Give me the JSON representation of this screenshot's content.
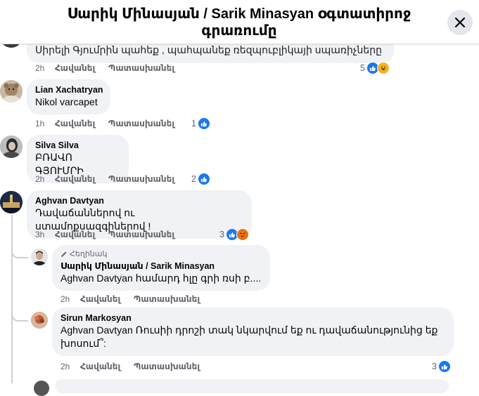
{
  "header": {
    "title": "Սարիկ Մինասյան / Sarik Minasyan օգտատիրոջ գրառումը",
    "close_label": "Close"
  },
  "comments": [
    {
      "id": "c0",
      "name": "",
      "text": "Սիրելի Գյումրին պահեք , պահպանեք ռեզպուբլիկայի սպառիչները",
      "time": "2h",
      "like": "Հավանել",
      "reply": "Պատասխանել",
      "react_count": "5",
      "reactions": [
        "like",
        "haha"
      ]
    },
    {
      "id": "c1",
      "name": "Lian Xachatryan",
      "text": "Nikol varcapet",
      "time": "1h",
      "like": "Հավանել",
      "reply": "Պատասխանել",
      "react_count": "1",
      "reactions": [
        "like"
      ]
    },
    {
      "id": "c2",
      "name": "Silva Silva",
      "text": "ԲՌԱՎՈ ԳՅՈՒՄՐԻ",
      "time": "2h",
      "like": "Հավանել",
      "reply": "Պատասխանել",
      "react_count": "2",
      "reactions": [
        "like"
      ]
    },
    {
      "id": "c3",
      "name": "Aghvan Davtyan",
      "text": "Դավաճաններով ու ստամոքսազգիներով !",
      "time": "3h",
      "like": "Հավանել",
      "reply": "Պատասխանել",
      "react_count": "3",
      "reactions": [
        "like",
        "angry"
      ]
    }
  ],
  "replies": [
    {
      "id": "r1",
      "author_tag": "Հեղինակ",
      "name": "Սարիկ Մինասյան / Sarik Minasyan",
      "mention": "Aghvan Davtyan",
      "text": " համարդ հլը գրի ռսի բ....",
      "time": "2h",
      "like": "Հավանել",
      "reply": "Պատասխանել"
    },
    {
      "id": "r2",
      "name": "Sirun Markosyan",
      "mention": "Aghvan Davtyan",
      "text": " Ռուսիի դրոշի տակ նկարվում եք ու դավաճանությունից եք խոսում՞:",
      "time": "2h",
      "like": "Հավանել",
      "reply": "Պատասխանել",
      "react_count": "3",
      "reactions": [
        "like"
      ]
    }
  ]
}
